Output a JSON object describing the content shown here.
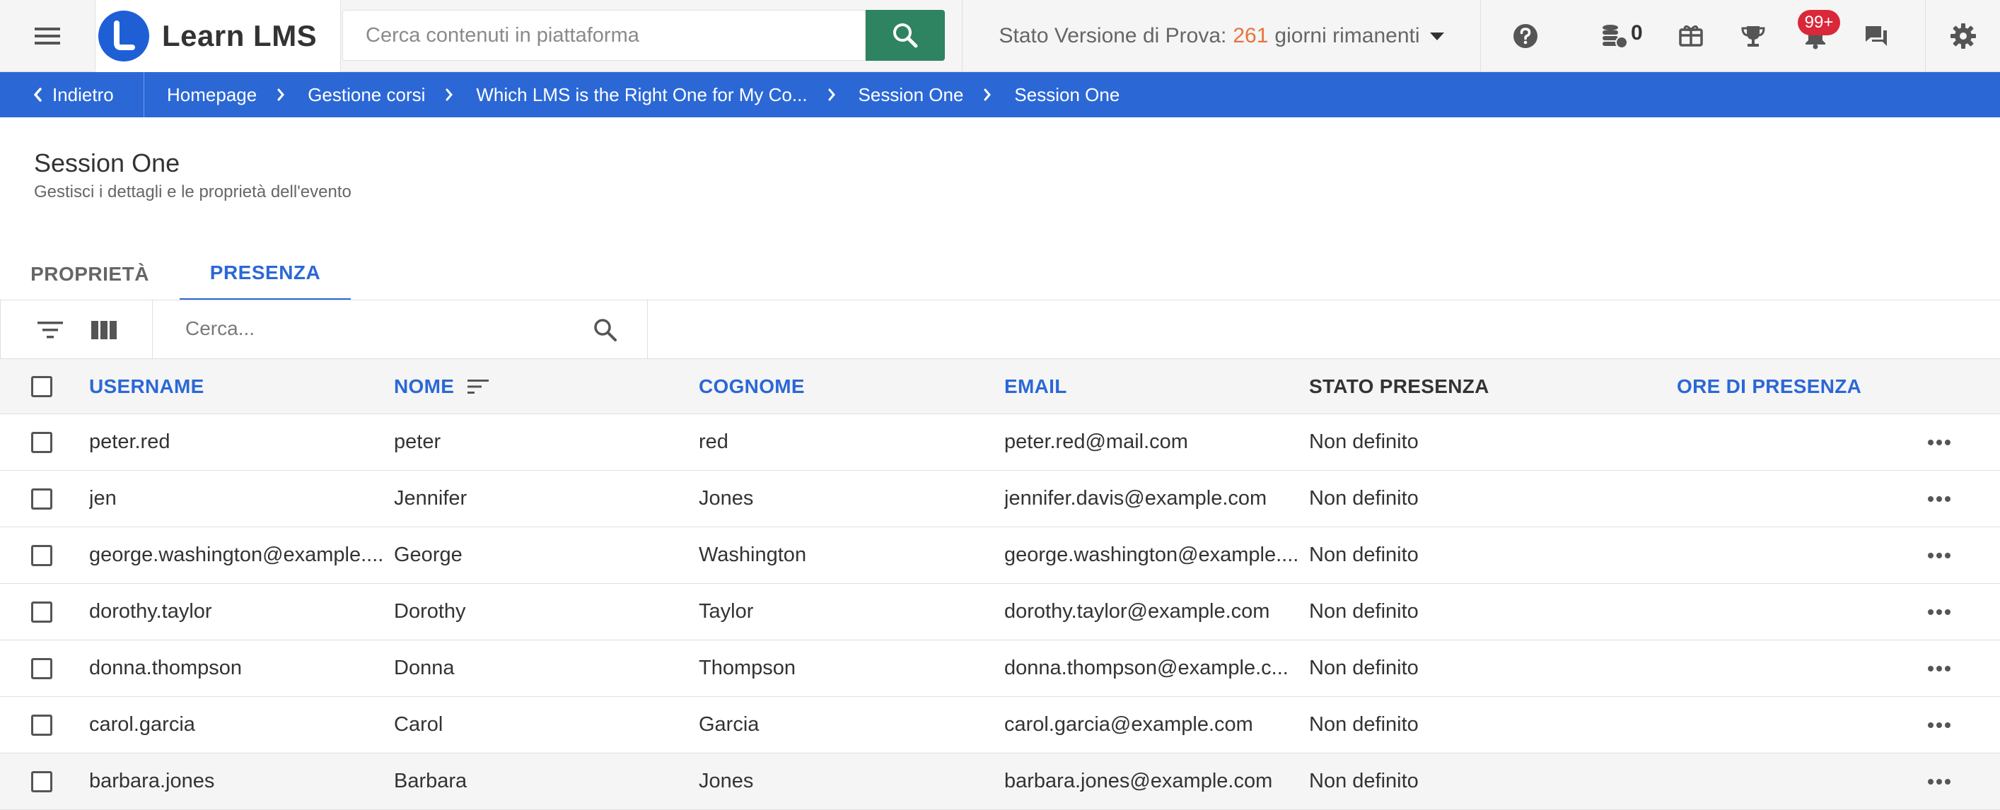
{
  "topbar": {
    "app_name": "Learn LMS",
    "search_placeholder": "Cerca contenuti in piattaforma",
    "trial_label": "Stato Versione di Prova:",
    "trial_days": "261",
    "trial_suffix": "giorni rimanenti",
    "coins_count": "0",
    "notifications_badge": "99+"
  },
  "breadcrumb": {
    "back_label": "Indietro",
    "items": [
      "Homepage",
      "Gestione corsi",
      "Which LMS is the Right One for My Co...",
      "Session One",
      "Session One"
    ]
  },
  "page": {
    "title": "Session One",
    "subtitle": "Gestisci i dettagli e le proprietà dell'evento"
  },
  "tabs": [
    {
      "label": "PROPRIETÀ",
      "active": false
    },
    {
      "label": "PRESENZA",
      "active": true
    }
  ],
  "toolbar": {
    "search_placeholder": "Cerca..."
  },
  "table": {
    "columns": {
      "username": "USERNAME",
      "nome": "NOME",
      "cognome": "COGNOME",
      "email": "EMAIL",
      "stato": "STATO PRESENZA",
      "ore": "ORE DI PRESENZA"
    },
    "rows": [
      {
        "username": "peter.red",
        "nome": "peter",
        "cognome": "red",
        "email": "peter.red@mail.com",
        "stato": "Non definito",
        "ore": ""
      },
      {
        "username": "jen",
        "nome": "Jennifer",
        "cognome": "Jones",
        "email": "jennifer.davis@example.com",
        "stato": "Non definito",
        "ore": ""
      },
      {
        "username": "george.washington@example....",
        "nome": "George",
        "cognome": "Washington",
        "email": "george.washington@example....",
        "stato": "Non definito",
        "ore": ""
      },
      {
        "username": "dorothy.taylor",
        "nome": "Dorothy",
        "cognome": "Taylor",
        "email": "dorothy.taylor@example.com",
        "stato": "Non definito",
        "ore": ""
      },
      {
        "username": "donna.thompson",
        "nome": "Donna",
        "cognome": "Thompson",
        "email": "donna.thompson@example.c...",
        "stato": "Non definito",
        "ore": ""
      },
      {
        "username": "carol.garcia",
        "nome": "Carol",
        "cognome": "Garcia",
        "email": "carol.garcia@example.com",
        "stato": "Non definito",
        "ore": ""
      },
      {
        "username": "barbara.jones",
        "nome": "Barbara",
        "cognome": "Jones",
        "email": "barbara.jones@example.com",
        "stato": "Non definito",
        "ore": ""
      }
    ]
  },
  "colors": {
    "brand_blue": "#2b68d6",
    "search_green": "#2e8360",
    "trial_orange": "#e8733c",
    "badge_red": "#d9283a"
  }
}
